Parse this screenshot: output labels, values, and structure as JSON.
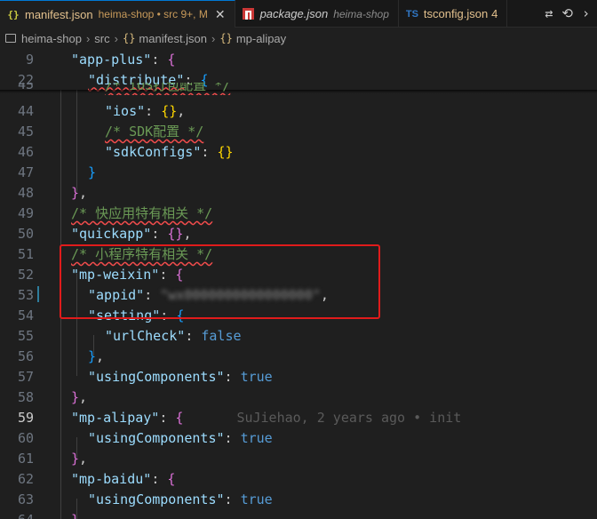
{
  "tabs": [
    {
      "name": "manifest.json",
      "desc": "heima-shop • src 9+, M",
      "close": "✕",
      "active": true,
      "icon": "json-braces-icon"
    },
    {
      "name": "package.json",
      "desc": "heima-shop",
      "active": false,
      "icon": "npm-icon"
    },
    {
      "name": "tsconfig.json",
      "badge": "4",
      "active": false,
      "icon": "ts-icon",
      "icon_text": "TS"
    }
  ],
  "breadcrumb": {
    "root": "heima-shop",
    "folder": "src",
    "file": "manifest.json",
    "symbol": "mp-alipay",
    "brace": "{}"
  },
  "lines": [
    {
      "n": "9",
      "t1": "\"app-plus\"",
      "t2": ": ",
      "t3": "{"
    },
    {
      "n": "22",
      "t1": "\"distribute\"",
      "t2": ": ",
      "t3": "{"
    },
    {
      "n": "43",
      "t1": "/* iOS打包配置 */"
    },
    {
      "n": "44",
      "t1": "\"ios\"",
      "t2": ": ",
      "t3": "{}",
      "t4": ","
    },
    {
      "n": "45",
      "t1": "/* SDK配置 */"
    },
    {
      "n": "46",
      "t1": "\"sdkConfigs\"",
      "t2": ": ",
      "t3": "{}"
    },
    {
      "n": "47",
      "t1": "}"
    },
    {
      "n": "48",
      "t1": "}",
      "t2": ","
    },
    {
      "n": "49",
      "t1": "/* 快应用特有相关 */"
    },
    {
      "n": "50",
      "t1": "\"quickapp\"",
      "t2": ": ",
      "t3": "{}",
      "t4": ","
    },
    {
      "n": "51",
      "t1": "/* 小程序特有相关 */"
    },
    {
      "n": "52",
      "t1": "\"mp-weixin\"",
      "t2": ": ",
      "t3": "{"
    },
    {
      "n": "53",
      "t1": "\"appid\"",
      "t2": ": ",
      "t3": "\"wx0000000000000000\"",
      "t4": ","
    },
    {
      "n": "54",
      "t1": "\"setting\"",
      "t2": ": ",
      "t3": "{"
    },
    {
      "n": "55",
      "t1": "\"urlCheck\"",
      "t2": ": ",
      "t3": "false"
    },
    {
      "n": "56",
      "t1": "}",
      "t2": ","
    },
    {
      "n": "57",
      "t1": "\"usingComponents\"",
      "t2": ": ",
      "t3": "true"
    },
    {
      "n": "58",
      "t1": "}",
      "t2": ","
    },
    {
      "n": "59",
      "t1": "\"mp-alipay\"",
      "t2": ": ",
      "t3": "{",
      "blame": "SuJiehao, 2 years ago • init"
    },
    {
      "n": "60",
      "t1": "\"usingComponents\"",
      "t2": ": ",
      "t3": "true"
    },
    {
      "n": "61",
      "t1": "}",
      "t2": ","
    },
    {
      "n": "62",
      "t1": "\"mp-baidu\"",
      "t2": ": ",
      "t3": "{"
    },
    {
      "n": "63",
      "t1": "\"usingComponents\"",
      "t2": ": ",
      "t3": "true"
    },
    {
      "n": "64",
      "t1": "}"
    }
  ],
  "colors": {
    "accent": "#0078d4",
    "highlight_box": "#e01b1b",
    "modified_tab": "#e2c08d"
  }
}
